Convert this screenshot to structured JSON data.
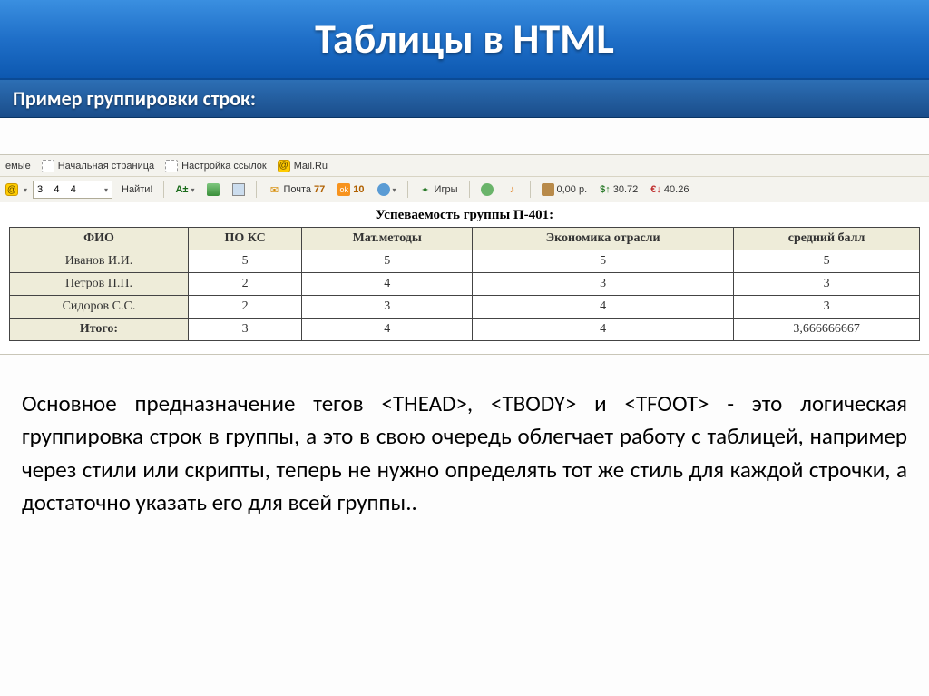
{
  "slide": {
    "title": "Таблицы в HTML",
    "subtitle": "Пример группировки строк:"
  },
  "browser": {
    "bookmarks": {
      "fragment": "емые",
      "home": "Начальная страница",
      "links": "Настройка ссылок",
      "mail": "Mail.Ru"
    },
    "toolbar": {
      "search_value": "3    4    4",
      "find": "Найти!",
      "aa": "A±",
      "mail_label": "Почта",
      "mail_count": "77",
      "od_count": "10",
      "games": "Игры",
      "money": "0,00 р.",
      "usd": "30.72",
      "eur": "40.26"
    }
  },
  "caption": "Успеваемость группы П-401:",
  "chart_data": {
    "type": "table",
    "columns": [
      "ФИО",
      "ПО КС",
      "Мат.методы",
      "Экономика отрасли",
      "средний балл"
    ],
    "rows": [
      {
        "name": "Иванов И.И.",
        "vals": [
          "5",
          "5",
          "5",
          "5"
        ]
      },
      {
        "name": "Петров П.П.",
        "vals": [
          "2",
          "4",
          "3",
          "3"
        ]
      },
      {
        "name": "Сидоров С.С.",
        "vals": [
          "2",
          "3",
          "4",
          "3"
        ]
      }
    ],
    "footer": {
      "name": "Итого:",
      "vals": [
        "3",
        "4",
        "4",
        "3,666666667"
      ]
    }
  },
  "body": "Основное предназначение тегов <THEAD>, <TBODY> и <TFOOT> - это логическая группировка строк в группы, а это в свою очередь облегчает работу с таблицей, например через стили или скрипты, теперь не нужно определять тот же стиль для каждой строчки, а достаточно указать его для всей группы.."
}
